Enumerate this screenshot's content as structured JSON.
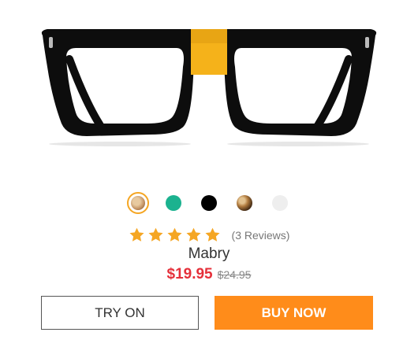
{
  "product": {
    "name": "Mabry",
    "image_icon": "eyeglasses-image",
    "frame_color": "#0d0d0d",
    "bridge_color": "#f5b21a"
  },
  "swatches": [
    {
      "name": "swatch-tan",
      "color": "#c89a6a",
      "selected": true
    },
    {
      "name": "swatch-teal",
      "color": "#1bb28f",
      "selected": false
    },
    {
      "name": "swatch-black",
      "color": "#000000",
      "selected": false
    },
    {
      "name": "swatch-tortoise",
      "color": "tortoise",
      "selected": false
    },
    {
      "name": "swatch-clear",
      "color": "#eeeeee",
      "selected": false
    }
  ],
  "rating": {
    "stars": 5,
    "star_color": "#f5a623",
    "reviews_text": "(3 Reviews)"
  },
  "price": {
    "current": "$19.95",
    "original": "$24.95",
    "current_color": "#e5303a"
  },
  "buttons": {
    "try_on": "TRY ON",
    "buy_now": "BUY NOW",
    "buy_color": "#ff8c1a"
  }
}
